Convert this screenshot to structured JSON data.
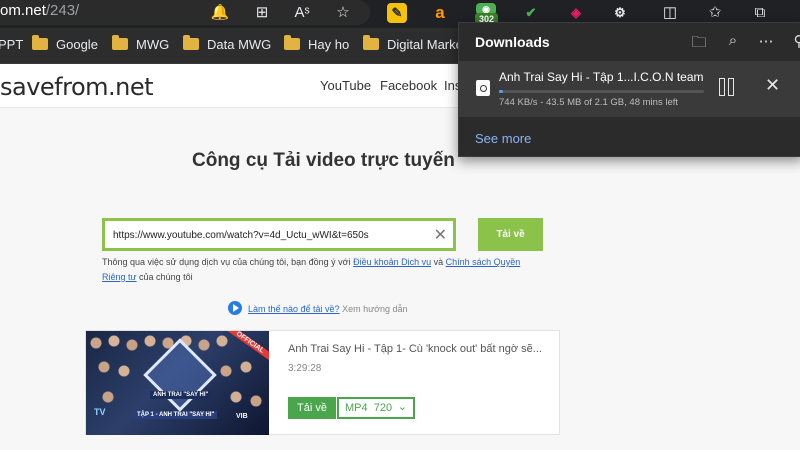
{
  "browser": {
    "url_host": "om.net",
    "url_path": "/243/",
    "toolbar_icons": [
      "bell-icon",
      "apps-grid-icon",
      "read-aloud-icon",
      "favorite-star-icon"
    ],
    "extensions": [
      {
        "name": "notes-extension-icon",
        "glyph": "✎",
        "color": "#f4c20d"
      },
      {
        "name": "amazon-extension-icon",
        "glyph": "a",
        "color": "#ff9900"
      },
      {
        "name": "tracker-extension-icon",
        "glyph": "◉",
        "color": "#4caf50",
        "badge": "302"
      },
      {
        "name": "user-check-extension-icon",
        "glyph": "✔",
        "color": "#4caf50"
      },
      {
        "name": "color-wheel-extension-icon",
        "glyph": "◈",
        "color": "#e91e63"
      },
      {
        "name": "puzzle-extensions-icon",
        "glyph": "⚙",
        "color": "#e8eaed"
      }
    ],
    "right_icons": [
      "split-screen-icon",
      "favorites-icon",
      "collections-icon"
    ]
  },
  "bookmarks": [
    {
      "label": "PPT",
      "folder": false
    },
    {
      "label": "Google",
      "folder": true
    },
    {
      "label": "MWG",
      "folder": true
    },
    {
      "label": "Data MWG",
      "folder": true
    },
    {
      "label": "Hay ho",
      "folder": true
    },
    {
      "label": "Digital Marke",
      "folder": true
    }
  ],
  "site": {
    "logo": "savefrom.net",
    "nav": [
      "YouTube",
      "Facebook",
      "Ins"
    ],
    "headline": "Công cụ Tải video trực tuyến",
    "input_value": "https://www.youtube.com/watch?v=4d_Uctu_wWI&t=650s",
    "download_button": "Tải về",
    "terms_prefix": "Thông qua việc sử dụng dịch vụ của chúng tôi, bạn đồng ý với ",
    "terms_link1": "Điều khoản Dịch vụ",
    "terms_and": " và ",
    "terms_link2": "Chính sách Quyền Riêng tư",
    "terms_suffix": " của chúng tôi",
    "howto_link": "Làm thế nào để tải về?",
    "howto_hint": " Xem hướng dẫn"
  },
  "result": {
    "title": "Anh Trai Say Hi - Tập 1- Cù 'knock out' bất ngờ sẽ...",
    "duration": "3:29:28",
    "download_label": "Tải về",
    "format": "MP4",
    "quality": "720",
    "thumbnail": {
      "logo_text": "ANH TRAI \"SAY HI\"",
      "official": "OFFICIAL",
      "caption": "TẬP 1 - ANH TRAI \"SAY HI\"",
      "sponsor": "VIB",
      "channel": "TV"
    }
  },
  "downloads": {
    "title": "Downloads",
    "item_name": "Anh Trai Say Hi - Tập 1...I.C.O.N team I",
    "progress": 0.02,
    "meta": "744 KB/s - 43.5 MB of 2.1 GB, 48 mins left",
    "see_more": "See more",
    "accent": "#4ea1ff"
  }
}
